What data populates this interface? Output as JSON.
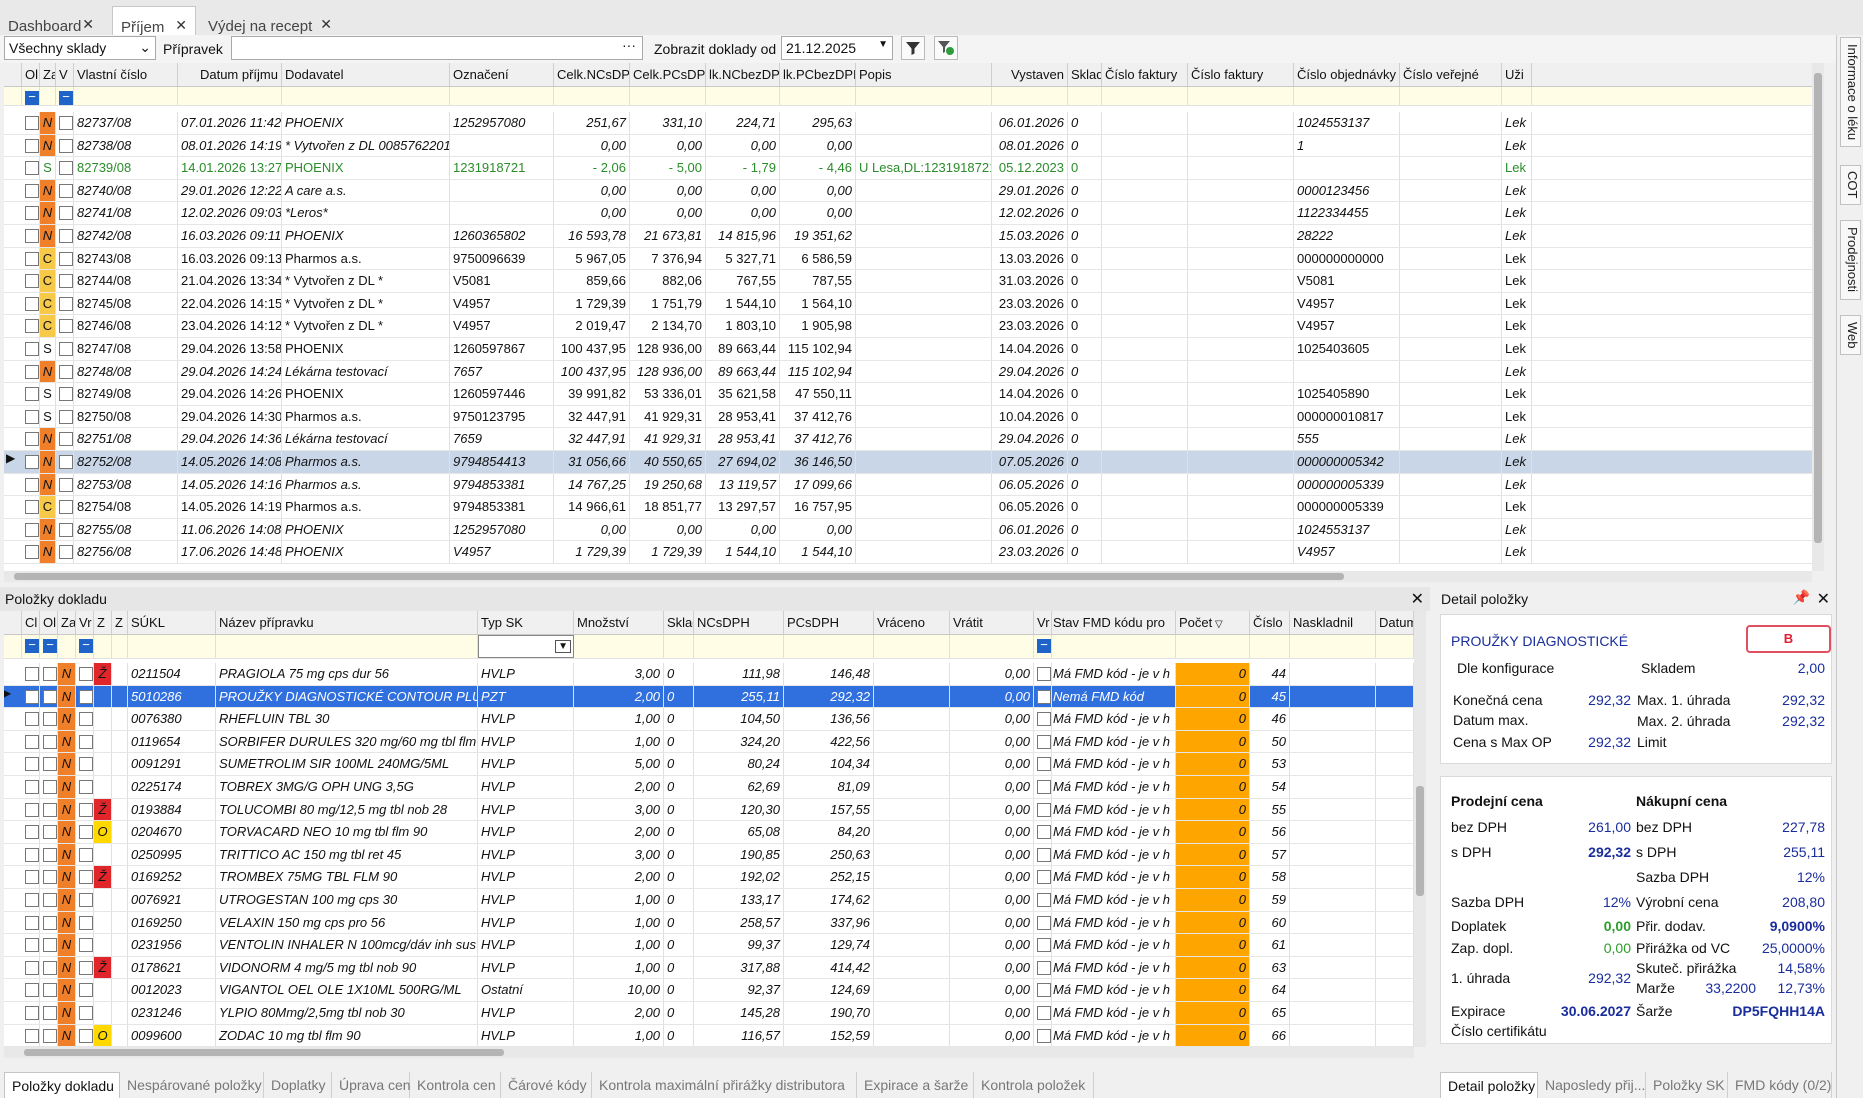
{
  "tabs": [
    {
      "label": "Dashboard"
    },
    {
      "label": "Příjem"
    },
    {
      "label": "Výdej na recept"
    }
  ],
  "filter": {
    "sklad": "Všechny sklady",
    "pripravek_label": "Přípravek",
    "pripravek_value": "",
    "zobrazit_label": "Zobrazit doklady od",
    "date": "21.12.2025"
  },
  "doklady": {
    "columns": [
      "Ol",
      "Za",
      "V",
      "Vlastní číslo",
      "Datum příjmu",
      "Dodavatel",
      "Označení",
      "Celk.NCsDPH",
      "Celk.PCsDPH",
      "lk.NCbezDPH",
      "lk.PCbezDPH",
      "Popis",
      "Vystaven",
      "Sklad",
      "Číslo faktury",
      "Číslo faktury",
      "Číslo objednávky",
      "Číslo veřejné",
      "Uži"
    ],
    "rows": [
      {
        "za": "N",
        "num": "82737/08",
        "dt": "07.01.2026 11:42",
        "dod": "PHOENIX",
        "ozn": "1252957080",
        "nc": "251,67",
        "pc": "331,10",
        "ncb": "224,71",
        "pcb": "295,63",
        "popis": "",
        "vys": "06.01.2026",
        "sklad": "0",
        "obj": "1024553137",
        "uz": "Lek"
      },
      {
        "za": "N",
        "num": "82738/08",
        "dt": "08.01.2026 14:19",
        "dod": "* Vytvořen z DL 0085762201 *",
        "ozn": "",
        "nc": "0,00",
        "pc": "0,00",
        "ncb": "0,00",
        "pcb": "0,00",
        "popis": "",
        "vys": "08.01.2026",
        "sklad": "0",
        "obj": "1",
        "uz": "Lek"
      },
      {
        "za": "S",
        "num": "82739/08",
        "dt": "14.01.2026 13:27",
        "dod": "PHOENIX",
        "ozn": "1231918721",
        "nc": "- 2,06",
        "pc": "- 5,00",
        "ncb": "- 1,79",
        "pcb": "- 4,46",
        "popis": "U Lesa,DL:1231918721",
        "vys": "05.12.2023",
        "sklad": "0",
        "obj": "",
        "uz": "Lek"
      },
      {
        "za": "N",
        "num": "82740/08",
        "dt": "29.01.2026 12:22",
        "dod": "A care a.s.",
        "ozn": "",
        "nc": "0,00",
        "pc": "0,00",
        "ncb": "0,00",
        "pcb": "0,00",
        "popis": "",
        "vys": "29.01.2026",
        "sklad": "0",
        "obj": "0000123456",
        "uz": "Lek"
      },
      {
        "za": "N",
        "num": "82741/08",
        "dt": "12.02.2026 09:03",
        "dod": "*Leros*",
        "ozn": "",
        "nc": "0,00",
        "pc": "0,00",
        "ncb": "0,00",
        "pcb": "0,00",
        "popis": "",
        "vys": "12.02.2026",
        "sklad": "0",
        "obj": "1122334455",
        "uz": "Lek"
      },
      {
        "za": "N",
        "num": "82742/08",
        "dt": "16.03.2026 09:11",
        "dod": "PHOENIX",
        "ozn": "1260365802",
        "nc": "16 593,78",
        "pc": "21 673,81",
        "ncb": "14 815,96",
        "pcb": "19 351,62",
        "popis": "",
        "vys": "15.03.2026",
        "sklad": "0",
        "obj": "28222",
        "uz": "Lek"
      },
      {
        "za": "C",
        "num": "82743/08",
        "dt": "16.03.2026 09:13",
        "dod": "Pharmos a.s.",
        "ozn": "9750096639",
        "nc": "5 967,05",
        "pc": "7 376,94",
        "ncb": "5 327,71",
        "pcb": "6 586,59",
        "popis": "",
        "vys": "13.03.2026",
        "sklad": "0",
        "obj": "000000000000",
        "uz": "Lek"
      },
      {
        "za": "C",
        "num": "82744/08",
        "dt": "21.04.2026 13:34",
        "dod": "* Vytvořen z DL *",
        "ozn": "V5081",
        "nc": "859,66",
        "pc": "882,06",
        "ncb": "767,55",
        "pcb": "787,55",
        "popis": "",
        "vys": "31.03.2026",
        "sklad": "0",
        "obj": "V5081",
        "uz": "Lek"
      },
      {
        "za": "C",
        "num": "82745/08",
        "dt": "22.04.2026 14:15",
        "dod": "* Vytvořen z DL *",
        "ozn": "V4957",
        "nc": "1 729,39",
        "pc": "1 751,79",
        "ncb": "1 544,10",
        "pcb": "1 564,10",
        "popis": "",
        "vys": "23.03.2026",
        "sklad": "0",
        "obj": "V4957",
        "uz": "Lek"
      },
      {
        "za": "C",
        "num": "82746/08",
        "dt": "23.04.2026 14:12",
        "dod": "* Vytvořen z DL *",
        "ozn": "V4957",
        "nc": "2 019,47",
        "pc": "2 134,70",
        "ncb": "1 803,10",
        "pcb": "1 905,98",
        "popis": "",
        "vys": "23.03.2026",
        "sklad": "0",
        "obj": "V4957",
        "uz": "Lek"
      },
      {
        "za": "S",
        "num": "82747/08",
        "dt": "29.04.2026 13:58",
        "dod": "PHOENIX",
        "ozn": "1260597867",
        "nc": "100 437,95",
        "pc": "128 936,00",
        "ncb": "89 663,44",
        "pcb": "115 102,94",
        "popis": "",
        "vys": "14.04.2026",
        "sklad": "0",
        "obj": "1025403605",
        "uz": "Lek"
      },
      {
        "za": "N",
        "num": "82748/08",
        "dt": "29.04.2026 14:24",
        "dod": "Lékárna testovací",
        "ozn": "7657",
        "nc": "100 437,95",
        "pc": "128 936,00",
        "ncb": "89 663,44",
        "pcb": "115 102,94",
        "popis": "",
        "vys": "29.04.2026",
        "sklad": "0",
        "obj": "",
        "uz": "Lek"
      },
      {
        "za": "S",
        "num": "82749/08",
        "dt": "29.04.2026 14:26",
        "dod": "PHOENIX",
        "ozn": "1260597446",
        "nc": "39 991,82",
        "pc": "53 336,01",
        "ncb": "35 621,58",
        "pcb": "47 550,11",
        "popis": "",
        "vys": "14.04.2026",
        "sklad": "0",
        "obj": "1025405890",
        "uz": "Lek"
      },
      {
        "za": "S",
        "num": "82750/08",
        "dt": "29.04.2026 14:30",
        "dod": "Pharmos a.s.",
        "ozn": "9750123795",
        "nc": "32 447,91",
        "pc": "41 929,31",
        "ncb": "28 953,41",
        "pcb": "37 412,76",
        "popis": "",
        "vys": "10.04.2026",
        "sklad": "0",
        "obj": "000000010817",
        "uz": "Lek"
      },
      {
        "za": "N",
        "num": "82751/08",
        "dt": "29.04.2026 14:36",
        "dod": "Lékárna testovací",
        "ozn": "7659",
        "nc": "32 447,91",
        "pc": "41 929,31",
        "ncb": "28 953,41",
        "pcb": "37 412,76",
        "popis": "",
        "vys": "29.04.2026",
        "sklad": "0",
        "obj": "555",
        "uz": "Lek"
      },
      {
        "za": "N",
        "num": "82752/08",
        "dt": "14.05.2026 14:08",
        "dod": "Pharmos a.s.",
        "ozn": "9794854413",
        "nc": "31 056,66",
        "pc": "40 550,65",
        "ncb": "27 694,02",
        "pcb": "36 146,50",
        "popis": "",
        "vys": "07.05.2026",
        "sklad": "0",
        "obj": "000000005342",
        "uz": "Lek"
      },
      {
        "za": "N",
        "num": "82753/08",
        "dt": "14.05.2026 14:16",
        "dod": "Pharmos a.s.",
        "ozn": "9794853381",
        "nc": "14 767,25",
        "pc": "19 250,68",
        "ncb": "13 119,57",
        "pcb": "17 099,66",
        "popis": "",
        "vys": "06.05.2026",
        "sklad": "0",
        "obj": "000000005339",
        "uz": "Lek"
      },
      {
        "za": "C",
        "num": "82754/08",
        "dt": "14.05.2026 14:19",
        "dod": "Pharmos a.s.",
        "ozn": "9794853381",
        "nc": "14 966,61",
        "pc": "18 851,77",
        "ncb": "13 297,57",
        "pcb": "16 757,95",
        "popis": "",
        "vys": "06.05.2026",
        "sklad": "0",
        "obj": "000000005339",
        "uz": "Lek"
      },
      {
        "za": "N",
        "num": "82755/08",
        "dt": "11.06.2026 14:08",
        "dod": "PHOENIX",
        "ozn": "1252957080",
        "nc": "0,00",
        "pc": "0,00",
        "ncb": "0,00",
        "pcb": "0,00",
        "popis": "",
        "vys": "06.01.2026",
        "sklad": "0",
        "obj": "1024553137",
        "uz": "Lek"
      },
      {
        "za": "N",
        "num": "82756/08",
        "dt": "17.06.2026 14:48",
        "dod": "PHOENIX",
        "ozn": "V4957",
        "nc": "1 729,39",
        "pc": "1 729,39",
        "ncb": "1 544,10",
        "pcb": "1 544,10",
        "popis": "",
        "vys": "23.03.2026",
        "sklad": "0",
        "obj": "V4957",
        "uz": "Lek"
      }
    ]
  },
  "polozky": {
    "title": "Položky dokladu",
    "columns": [
      "Cl",
      "Ol",
      "Za",
      "Vr",
      "Z",
      "Z",
      "SÚKL",
      "Název přípravku",
      "Typ SK",
      "Množství",
      "Sklad",
      "NCsDPH",
      "PCsDPH",
      "Vráceno",
      "Vrátit",
      "Vr",
      "Stav FMD kódu pro",
      "Počet",
      "Číslo",
      "Naskladnil",
      "Datum"
    ],
    "rows": [
      {
        "z": "Ž",
        "sukl": "0211504",
        "name": "PRAGIOLA 75 mg cps dur 56",
        "typ": "HVLP",
        "mn": "3,00",
        "sk": "0",
        "nc": "111,98",
        "pc": "146,48",
        "vr": "0,00",
        "fmd": "Má FMD kód - je v h",
        "poc": "0",
        "cis": "44"
      },
      {
        "z": "",
        "sukl": "5010286",
        "name": "PROUŽKY DIAGNOSTICKÉ CONTOUR PLUS",
        "typ": "PZT",
        "mn": "2,00",
        "sk": "0",
        "nc": "255,11",
        "pc": "292,32",
        "vr": "0,00",
        "fmd": "Nemá FMD kód",
        "poc": "0",
        "cis": "45"
      },
      {
        "z": "",
        "sukl": "0076380",
        "name": "RHEFLUIN TBL 30",
        "typ": "HVLP",
        "mn": "1,00",
        "sk": "0",
        "nc": "104,50",
        "pc": "136,56",
        "vr": "0,00",
        "fmd": "Má FMD kód - je v h",
        "poc": "0",
        "cis": "46"
      },
      {
        "z": "",
        "sukl": "0119654",
        "name": "SORBIFER DURULES 320 mg/60 mg tbl flm",
        "typ": "HVLP",
        "mn": "1,00",
        "sk": "0",
        "nc": "324,20",
        "pc": "422,56",
        "vr": "0,00",
        "fmd": "Má FMD kód - je v h",
        "poc": "0",
        "cis": "50"
      },
      {
        "z": "",
        "sukl": "0091291",
        "name": "SUMETROLIM SIR 100ML 240MG/5ML",
        "typ": "HVLP",
        "mn": "5,00",
        "sk": "0",
        "nc": "80,24",
        "pc": "104,34",
        "vr": "0,00",
        "fmd": "Má FMD kód - je v h",
        "poc": "0",
        "cis": "53"
      },
      {
        "z": "",
        "sukl": "0225174",
        "name": "TOBREX 3MG/G OPH UNG 3,5G",
        "typ": "HVLP",
        "mn": "2,00",
        "sk": "0",
        "nc": "62,69",
        "pc": "81,09",
        "vr": "0,00",
        "fmd": "Má FMD kód - je v h",
        "poc": "0",
        "cis": "54"
      },
      {
        "z": "Ž",
        "sukl": "0193884",
        "name": "TOLUCOMBI 80 mg/12,5 mg tbl nob 28",
        "typ": "HVLP",
        "mn": "3,00",
        "sk": "0",
        "nc": "120,30",
        "pc": "157,55",
        "vr": "0,00",
        "fmd": "Má FMD kód - je v h",
        "poc": "0",
        "cis": "55"
      },
      {
        "z": "O",
        "sukl": "0204670",
        "name": "TORVACARD NEO 10 mg tbl flm 90",
        "typ": "HVLP",
        "mn": "2,00",
        "sk": "0",
        "nc": "65,08",
        "pc": "84,20",
        "vr": "0,00",
        "fmd": "Má FMD kód - je v h",
        "poc": "0",
        "cis": "56"
      },
      {
        "z": "",
        "sukl": "0250995",
        "name": "TRITTICO AC 150 mg tbl ret 45",
        "typ": "HVLP",
        "mn": "3,00",
        "sk": "0",
        "nc": "190,85",
        "pc": "250,63",
        "vr": "0,00",
        "fmd": "Má FMD kód - je v h",
        "poc": "0",
        "cis": "57"
      },
      {
        "z": "Ž",
        "sukl": "0169252",
        "name": "TROMBEX 75MG TBL FLM 90",
        "typ": "HVLP",
        "mn": "2,00",
        "sk": "0",
        "nc": "192,02",
        "pc": "252,15",
        "vr": "0,00",
        "fmd": "Má FMD kód - je v h",
        "poc": "0",
        "cis": "58"
      },
      {
        "z": "",
        "sukl": "0076921",
        "name": "UTROGESTAN 100 mg cps 30",
        "typ": "HVLP",
        "mn": "1,00",
        "sk": "0",
        "nc": "133,17",
        "pc": "174,62",
        "vr": "0,00",
        "fmd": "Má FMD kód - je v h",
        "poc": "0",
        "cis": "59"
      },
      {
        "z": "",
        "sukl": "0169250",
        "name": "VELAXIN 150 mg cps pro 56",
        "typ": "HVLP",
        "mn": "1,00",
        "sk": "0",
        "nc": "258,57",
        "pc": "337,96",
        "vr": "0,00",
        "fmd": "Má FMD kód - je v h",
        "poc": "0",
        "cis": "60"
      },
      {
        "z": "",
        "sukl": "0231956",
        "name": "VENTOLIN INHALER N 100mcg/dáv inh sus",
        "typ": "HVLP",
        "mn": "1,00",
        "sk": "0",
        "nc": "99,37",
        "pc": "129,74",
        "vr": "0,00",
        "fmd": "Má FMD kód - je v h",
        "poc": "0",
        "cis": "61"
      },
      {
        "z": "Ž",
        "sukl": "0178621",
        "name": "VIDONORM 4 mg/5 mg tbl nob 90",
        "typ": "HVLP",
        "mn": "1,00",
        "sk": "0",
        "nc": "317,88",
        "pc": "414,42",
        "vr": "0,00",
        "fmd": "Má FMD kód - je v h",
        "poc": "0",
        "cis": "63"
      },
      {
        "z": "",
        "sukl": "0012023",
        "name": "VIGANTOL OEL OLE 1X10ML 500RG/ML",
        "typ": "Ostatní",
        "mn": "10,00",
        "sk": "0",
        "nc": "92,37",
        "pc": "124,69",
        "vr": "0,00",
        "fmd": "Má FMD kód - je v h",
        "poc": "0",
        "cis": "64"
      },
      {
        "z": "",
        "sukl": "0231246",
        "name": "YLPIO 80Mmg/2,5mg tbl nob 30",
        "typ": "HVLP",
        "mn": "2,00",
        "sk": "0",
        "nc": "145,28",
        "pc": "190,70",
        "vr": "0,00",
        "fmd": "Má FMD kód - je v h",
        "poc": "0",
        "cis": "65"
      },
      {
        "z": "O",
        "sukl": "0099600",
        "name": "ZODAC 10 mg tbl flm 90",
        "typ": "HVLP",
        "mn": "1,00",
        "sk": "0",
        "nc": "116,57",
        "pc": "152,59",
        "vr": "0,00",
        "fmd": "Má FMD kód - je v h",
        "poc": "0",
        "cis": "66"
      }
    ]
  },
  "detail": {
    "title": "Detail položky",
    "name": "PROUŽKY DIAGNOSTICKÉ",
    "badge": "B",
    "dle_konfigurace": "Dle konfigurace",
    "skladem_label": "Skladem",
    "skladem": "2,00",
    "konecna_label": "Konečná cena",
    "konecna": "292,32",
    "max1_label": "Max. 1. úhrada",
    "max1": "292,32",
    "datum_max_label": "Datum max.",
    "max2_label": "Max. 2. úhrada",
    "max2": "292,32",
    "cena_max_label": "Cena s Max OP",
    "cena_max": "292,32",
    "limit_label": "Limit",
    "prodejni_title": "Prodejní cena",
    "nakupni_title": "Nákupní cena",
    "bez_dph_label": "bez DPH",
    "p_bez": "261,00",
    "n_bez": "227,78",
    "s_dph_label": "s DPH",
    "p_s": "292,32",
    "n_s": "255,11",
    "sazba_label": "Sazba DPH",
    "n_sazba": "12%",
    "p_sazba": "12%",
    "vyrobni_label": "Výrobní cena",
    "vyrobni": "208,80",
    "doplatek_label": "Doplatek",
    "doplatek": "0,00",
    "prir_dodav_label": "Přir. dodav.",
    "prir_dodav": "9,0900%",
    "zap_dopl_label": "Zap. dopl.",
    "zap_dopl": "0,00",
    "prirazka_vc_label": "Přirážka od VC",
    "prirazka_vc": "25,0000%",
    "skutec_label": "Skuteč. přirážka",
    "skutec": "14,58%",
    "uhrada_label": "1. úhrada",
    "uhrada": "292,32",
    "marze_label": "Marže",
    "marze1": "33,2200",
    "marze2": "12,73%",
    "expirace_label": "Expirace",
    "expirace": "30.06.2027",
    "sarze_label": "Šarže",
    "sarze": "DP5FQHH14A",
    "certifikat_label": "Číslo certifikátu"
  },
  "vtabs": [
    "Informace o léku",
    "COT",
    "Prodejnosti",
    "Web"
  ],
  "bottom_tabs": [
    "Položky dokladu",
    "Nespárované položky",
    "Doplatky",
    "Úprava cen",
    "Kontrola cen",
    "Čárové kódy",
    "Kontrola maximální přirážky distributora",
    "Expirace a šarže",
    "Kontrola položek"
  ],
  "detail_tabs": [
    "Detail položky",
    "Naposledy přij...",
    "Položky SK",
    "FMD kódy (0/2)"
  ],
  "colors": {
    "za_orange": "#f07f2a",
    "za_yellow": "#f7c948",
    "z_red": "#e0262a",
    "z_yellow": "#ffd800",
    "fmd_orange": "#ffa500",
    "selected_row": "#2f6fde",
    "highlight_row": "#c9d6e8"
  }
}
